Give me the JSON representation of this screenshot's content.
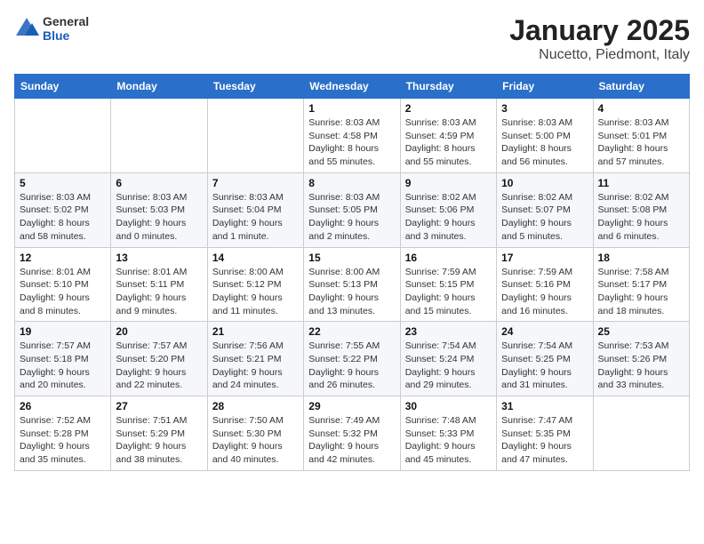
{
  "logo": {
    "general": "General",
    "blue": "Blue"
  },
  "title": "January 2025",
  "subtitle": "Nucetto, Piedmont, Italy",
  "days_of_week": [
    "Sunday",
    "Monday",
    "Tuesday",
    "Wednesday",
    "Thursday",
    "Friday",
    "Saturday"
  ],
  "weeks": [
    [
      {
        "day": "",
        "info": ""
      },
      {
        "day": "",
        "info": ""
      },
      {
        "day": "",
        "info": ""
      },
      {
        "day": "1",
        "info": "Sunrise: 8:03 AM\nSunset: 4:58 PM\nDaylight: 8 hours\nand 55 minutes."
      },
      {
        "day": "2",
        "info": "Sunrise: 8:03 AM\nSunset: 4:59 PM\nDaylight: 8 hours\nand 55 minutes."
      },
      {
        "day": "3",
        "info": "Sunrise: 8:03 AM\nSunset: 5:00 PM\nDaylight: 8 hours\nand 56 minutes."
      },
      {
        "day": "4",
        "info": "Sunrise: 8:03 AM\nSunset: 5:01 PM\nDaylight: 8 hours\nand 57 minutes."
      }
    ],
    [
      {
        "day": "5",
        "info": "Sunrise: 8:03 AM\nSunset: 5:02 PM\nDaylight: 8 hours\nand 58 minutes."
      },
      {
        "day": "6",
        "info": "Sunrise: 8:03 AM\nSunset: 5:03 PM\nDaylight: 9 hours\nand 0 minutes."
      },
      {
        "day": "7",
        "info": "Sunrise: 8:03 AM\nSunset: 5:04 PM\nDaylight: 9 hours\nand 1 minute."
      },
      {
        "day": "8",
        "info": "Sunrise: 8:03 AM\nSunset: 5:05 PM\nDaylight: 9 hours\nand 2 minutes."
      },
      {
        "day": "9",
        "info": "Sunrise: 8:02 AM\nSunset: 5:06 PM\nDaylight: 9 hours\nand 3 minutes."
      },
      {
        "day": "10",
        "info": "Sunrise: 8:02 AM\nSunset: 5:07 PM\nDaylight: 9 hours\nand 5 minutes."
      },
      {
        "day": "11",
        "info": "Sunrise: 8:02 AM\nSunset: 5:08 PM\nDaylight: 9 hours\nand 6 minutes."
      }
    ],
    [
      {
        "day": "12",
        "info": "Sunrise: 8:01 AM\nSunset: 5:10 PM\nDaylight: 9 hours\nand 8 minutes."
      },
      {
        "day": "13",
        "info": "Sunrise: 8:01 AM\nSunset: 5:11 PM\nDaylight: 9 hours\nand 9 minutes."
      },
      {
        "day": "14",
        "info": "Sunrise: 8:00 AM\nSunset: 5:12 PM\nDaylight: 9 hours\nand 11 minutes."
      },
      {
        "day": "15",
        "info": "Sunrise: 8:00 AM\nSunset: 5:13 PM\nDaylight: 9 hours\nand 13 minutes."
      },
      {
        "day": "16",
        "info": "Sunrise: 7:59 AM\nSunset: 5:15 PM\nDaylight: 9 hours\nand 15 minutes."
      },
      {
        "day": "17",
        "info": "Sunrise: 7:59 AM\nSunset: 5:16 PM\nDaylight: 9 hours\nand 16 minutes."
      },
      {
        "day": "18",
        "info": "Sunrise: 7:58 AM\nSunset: 5:17 PM\nDaylight: 9 hours\nand 18 minutes."
      }
    ],
    [
      {
        "day": "19",
        "info": "Sunrise: 7:57 AM\nSunset: 5:18 PM\nDaylight: 9 hours\nand 20 minutes."
      },
      {
        "day": "20",
        "info": "Sunrise: 7:57 AM\nSunset: 5:20 PM\nDaylight: 9 hours\nand 22 minutes."
      },
      {
        "day": "21",
        "info": "Sunrise: 7:56 AM\nSunset: 5:21 PM\nDaylight: 9 hours\nand 24 minutes."
      },
      {
        "day": "22",
        "info": "Sunrise: 7:55 AM\nSunset: 5:22 PM\nDaylight: 9 hours\nand 26 minutes."
      },
      {
        "day": "23",
        "info": "Sunrise: 7:54 AM\nSunset: 5:24 PM\nDaylight: 9 hours\nand 29 minutes."
      },
      {
        "day": "24",
        "info": "Sunrise: 7:54 AM\nSunset: 5:25 PM\nDaylight: 9 hours\nand 31 minutes."
      },
      {
        "day": "25",
        "info": "Sunrise: 7:53 AM\nSunset: 5:26 PM\nDaylight: 9 hours\nand 33 minutes."
      }
    ],
    [
      {
        "day": "26",
        "info": "Sunrise: 7:52 AM\nSunset: 5:28 PM\nDaylight: 9 hours\nand 35 minutes."
      },
      {
        "day": "27",
        "info": "Sunrise: 7:51 AM\nSunset: 5:29 PM\nDaylight: 9 hours\nand 38 minutes."
      },
      {
        "day": "28",
        "info": "Sunrise: 7:50 AM\nSunset: 5:30 PM\nDaylight: 9 hours\nand 40 minutes."
      },
      {
        "day": "29",
        "info": "Sunrise: 7:49 AM\nSunset: 5:32 PM\nDaylight: 9 hours\nand 42 minutes."
      },
      {
        "day": "30",
        "info": "Sunrise: 7:48 AM\nSunset: 5:33 PM\nDaylight: 9 hours\nand 45 minutes."
      },
      {
        "day": "31",
        "info": "Sunrise: 7:47 AM\nSunset: 5:35 PM\nDaylight: 9 hours\nand 47 minutes."
      },
      {
        "day": "",
        "info": ""
      }
    ]
  ]
}
